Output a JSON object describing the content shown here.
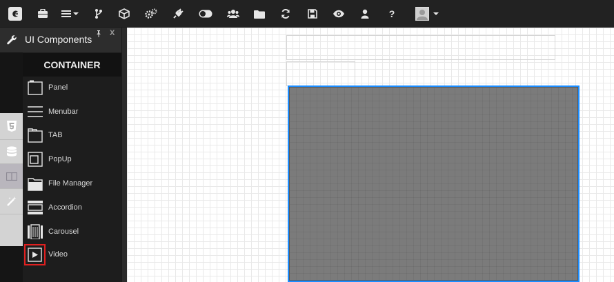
{
  "panel": {
    "title": "UI Components",
    "category": "CONTAINER",
    "items": [
      {
        "label": "Panel"
      },
      {
        "label": "Menubar"
      },
      {
        "label": "TAB"
      },
      {
        "label": "PopUp"
      },
      {
        "label": "File Manager"
      },
      {
        "label": "Accordion"
      },
      {
        "label": "Carousel"
      },
      {
        "label": "Video"
      }
    ],
    "close_label": "X",
    "pin_label": "📌"
  },
  "toolbar": {
    "help_label": "?"
  },
  "colors": {
    "selection": "#1a8cff",
    "highlight": "#e02020",
    "toolbar_bg": "#222222"
  },
  "icons": [
    "app-logo-icon",
    "briefcase-icon",
    "menu-icon",
    "branch-icon",
    "cube-icon",
    "cogs-icon",
    "plug-icon",
    "toggle-icon",
    "users-icon",
    "folder-icon",
    "refresh-icon",
    "save-icon",
    "eye-icon",
    "user-icon",
    "help-icon",
    "avatar-icon",
    "wrench-icon",
    "pin-icon",
    "html5-icon",
    "database-icon",
    "layout-icon",
    "magic-wand-icon"
  ]
}
